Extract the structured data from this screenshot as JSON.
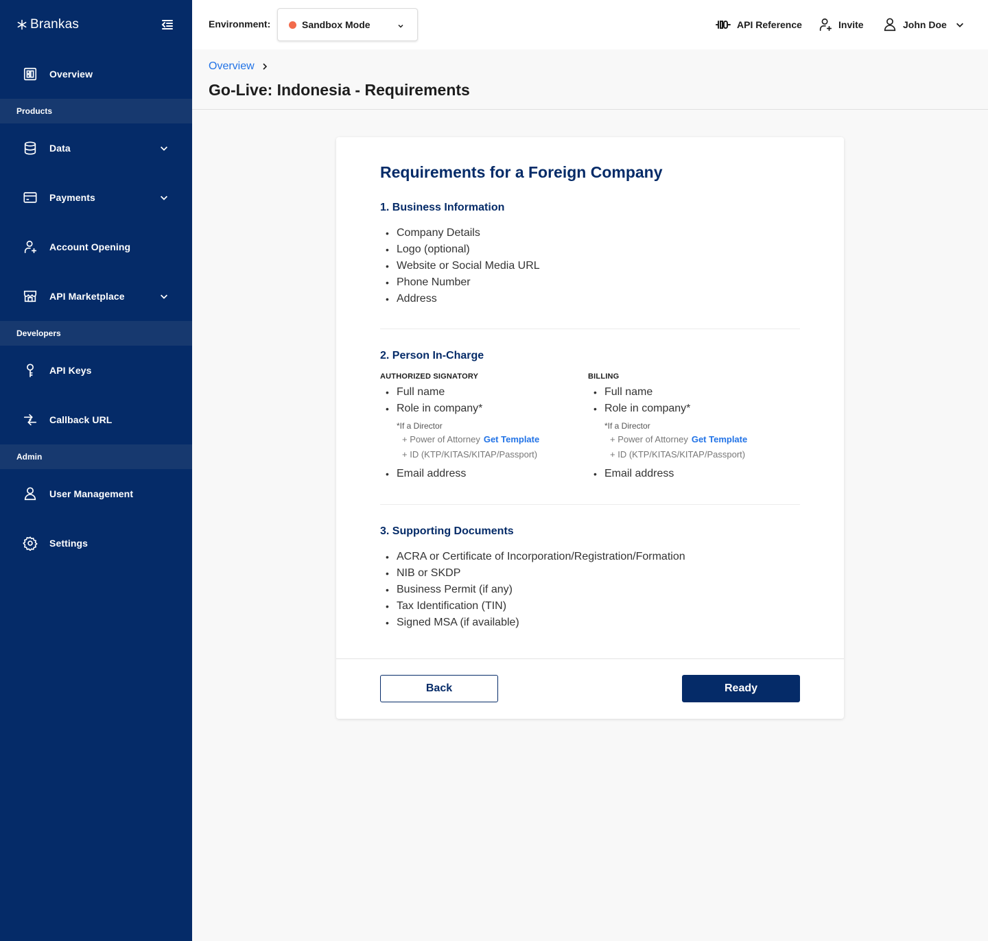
{
  "brand": {
    "name": "Brankas"
  },
  "sidebar": {
    "overview": "Overview",
    "sections": {
      "products": "Products",
      "developers": "Developers",
      "admin": "Admin"
    },
    "items": {
      "data": "Data",
      "payments": "Payments",
      "account_opening": "Account Opening",
      "api_marketplace": "API Marketplace",
      "api_keys": "API Keys",
      "callback_url": "Callback URL",
      "user_management": "User Management",
      "settings": "Settings"
    }
  },
  "topbar": {
    "environment_label": "Environment:",
    "environment_value": "Sandbox Mode",
    "api_reference": "API Reference",
    "invite": "Invite",
    "user_name": "John Doe"
  },
  "header": {
    "breadcrumb": "Overview",
    "title": "Go-Live: Indonesia - Requirements"
  },
  "card": {
    "title": "Requirements for a Foreign Company",
    "business": {
      "title": "1. Business Information",
      "items": [
        "Company Details",
        "Logo (optional)",
        "Website or Social Media URL",
        "Phone Number",
        "Address"
      ]
    },
    "person": {
      "title": "2. Person In-Charge",
      "signatory": {
        "heading": "AUTHORIZED SIGNATORY",
        "full_name": "Full name",
        "role": "Role in company*",
        "director_note": "*If a Director",
        "power_of_attorney": "+ Power of Attorney",
        "get_template": "Get Template",
        "id_doc": "+ ID (KTP/KITAS/KITAP/Passport)",
        "email": "Email address"
      },
      "billing": {
        "heading": "BILLING",
        "full_name": "Full name",
        "role": "Role in company*",
        "director_note": "*If a Director",
        "power_of_attorney": "+ Power of Attorney",
        "get_template": "Get Template",
        "id_doc": "+ ID (KTP/KITAS/KITAP/Passport)",
        "email": "Email address"
      }
    },
    "documents": {
      "title": "3. Supporting Documents",
      "items": [
        "ACRA or Certificate of Incorporation/Registration/Formation",
        "NIB or SKDP",
        "Business Permit (if any)",
        "Tax Identification (TIN)",
        "Signed MSA (if available)"
      ]
    },
    "back_label": "Back",
    "ready_label": "Ready"
  },
  "colors": {
    "sidebar_bg": "#052b68",
    "section_bg": "#17396f",
    "accent": "#052b68",
    "link": "#2273e6",
    "sandbox_dot": "#f26b4c"
  }
}
